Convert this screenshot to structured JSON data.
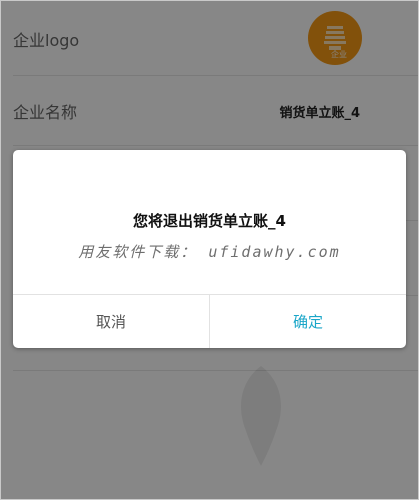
{
  "settings": {
    "logo_label": "企业logo",
    "logo_badge_text": "企业",
    "company_name_label": "企业名称",
    "company_name_value": "销货单立账_4"
  },
  "dialog": {
    "message": "您将退出销货单立账_4",
    "watermark": "用友软件下载： ufidawhy.com",
    "cancel_label": "取消",
    "confirm_label": "确定"
  },
  "theme": {
    "accent": "#1aa6c8",
    "logo_color": "#f59a16"
  },
  "icons": {
    "logo": "company-logo-icon"
  }
}
